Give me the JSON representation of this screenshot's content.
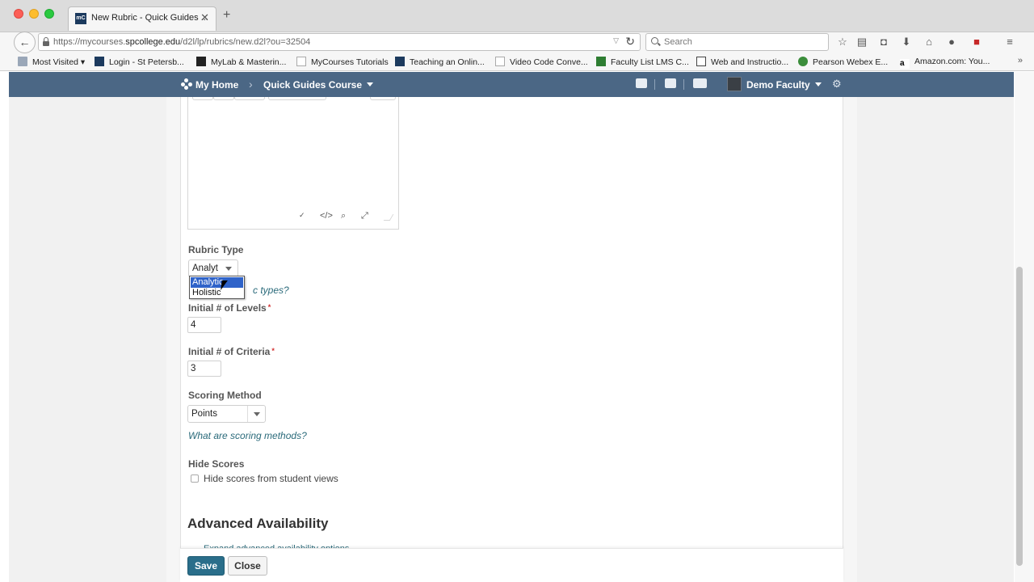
{
  "browser": {
    "tab_title": "New Rubric - Quick Guides ...",
    "url_prefix": "https://mycourses.",
    "url_domain": "spcollege.edu",
    "url_path": "/d2l/lp/rubrics/new.d2l?ou=32504",
    "search_placeholder": "Search",
    "bookmarks": [
      {
        "label": "Most Visited ▾"
      },
      {
        "label": "Login - St Petersb..."
      },
      {
        "label": "MyLab & Masterin..."
      },
      {
        "label": "MyCourses Tutorials"
      },
      {
        "label": "Teaching an Onlin..."
      },
      {
        "label": "Video Code Conve..."
      },
      {
        "label": "Faculty List LMS C..."
      },
      {
        "label": "Web and Instructio..."
      },
      {
        "label": "Pearson Webex E..."
      },
      {
        "label": "Amazon.com: You..."
      }
    ]
  },
  "nav": {
    "home": "My Home",
    "course": "Quick Guides Course",
    "user": "Demo Faculty"
  },
  "form": {
    "rubric_type": {
      "label": "Rubric Type",
      "value": "Analyt",
      "options": [
        "Analytic",
        "Holistic"
      ],
      "help_link": "c types?"
    },
    "levels": {
      "label": "Initial # of Levels",
      "required": "*",
      "value": "4"
    },
    "criteria": {
      "label": "Initial # of Criteria",
      "required": "*",
      "value": "3"
    },
    "scoring": {
      "label": "Scoring Method",
      "value": "Points",
      "help_link": "What are scoring methods?"
    },
    "hide_scores": {
      "label": "Hide Scores",
      "checkbox_label": "Hide scores from student views"
    },
    "advanced": {
      "heading": "Advanced Availability",
      "expand_link": "Expand advanced availability options"
    }
  },
  "actions": {
    "save": "Save",
    "close": "Close"
  },
  "colors": {
    "nav_bg": "#4b6785",
    "primary_button": "#2a6e8a",
    "link": "#2a6a7a",
    "selected_option": "#2f63c9"
  }
}
